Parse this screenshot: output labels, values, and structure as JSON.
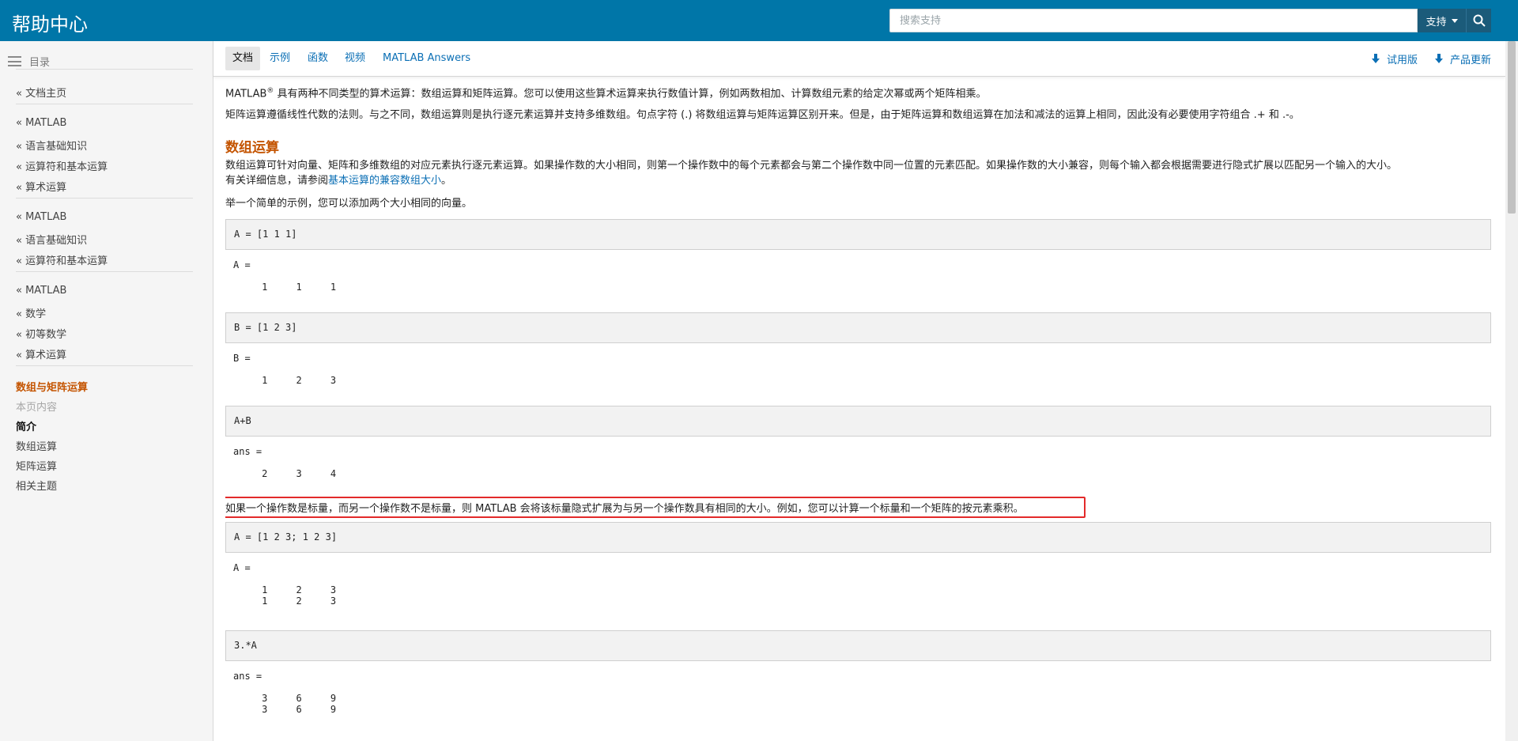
{
  "header": {
    "brand": "帮助中心",
    "search_placeholder": "搜索支持",
    "support_label": "支持"
  },
  "sidebar": {
    "toc_label": "目录",
    "items": [
      "« 文档主页",
      "« MATLAB",
      "« 语言基础知识",
      "« 运算符和基本运算",
      "« 算术运算",
      "« MATLAB",
      "« 语言基础知识",
      "« 运算符和基本运算",
      "« MATLAB",
      "« 数学",
      "« 初等数学",
      "« 算术运算"
    ],
    "current": "数组与矩阵运算",
    "on_this_page": "本页内容",
    "page_sections": [
      "简介",
      "数组运算",
      "矩阵运算",
      "相关主题"
    ]
  },
  "subnav": {
    "tabs": [
      "文档",
      "示例",
      "函数",
      "视频",
      "MATLAB Answers"
    ],
    "trial": "试用版",
    "updates": "产品更新"
  },
  "content": {
    "intro_1a": "MATLAB",
    "intro_1_sup": "®",
    "intro_1b": " 具有两种不同类型的算术运算：数组运算和矩阵运算。您可以使用这些算术运算来执行数值计算，例如两数相加、计算数组元素的给定次幂或两个矩阵相乘。",
    "intro_2": "矩阵运算遵循线性代数的法则。与之不同，数组运算则是执行逐元素运算并支持多维数组。句点字符 (.) 将数组运算与矩阵运算区别开来。但是，由于矩阵运算和数组运算在加法和减法的运算上相同，因此没有必要使用字符组合 .+ 和 .-。",
    "section_title": "数组运算",
    "array_para_1": "数组运算可针对向量、矩阵和多维数组的对应元素执行逐元素运算。如果操作数的大小相同，则第一个操作数中的每个元素都会与第二个操作数中同一位置的元素匹配。如果操作数的大小兼容，则每个输入都会根据需要进行隐式扩展以匹配另一个输入的大小。",
    "array_para_2a": "有关详细信息，请参阅",
    "array_para_2_link": "基本运算的兼容数组大小",
    "array_para_2b": "。",
    "example_intro": "举一个简单的示例，您可以添加两个大小相同的向量。",
    "code": [
      {
        "cmd": "A = [1 1 1]",
        "out": "A =\n\n     1     1     1"
      },
      {
        "cmd": "B = [1 2 3]",
        "out": "B =\n\n     1     2     3"
      },
      {
        "cmd": "A+B",
        "out": "ans =\n\n     2     3     4"
      },
      {
        "cmd": "A = [1 2 3; 1 2 3]",
        "out": "A =\n\n     1     2     3\n     1     2     3"
      },
      {
        "cmd": "3.*A",
        "out": "ans =\n\n     3     6     9\n     3     6     9"
      }
    ],
    "highlighted_text": "如果一个操作数是标量，而另一个操作数不是标量，则 MATLAB 会将该标量隐式扩展为与另一个操作数具有相同的大小。例如，您可以计算一个标量和一个矩阵的按元素乘积。"
  },
  "colors": {
    "header_bg": "#0076a8",
    "accent_orange": "#c45400",
    "link_blue": "#0b6fb5",
    "highlight_red": "#e32a2a"
  }
}
